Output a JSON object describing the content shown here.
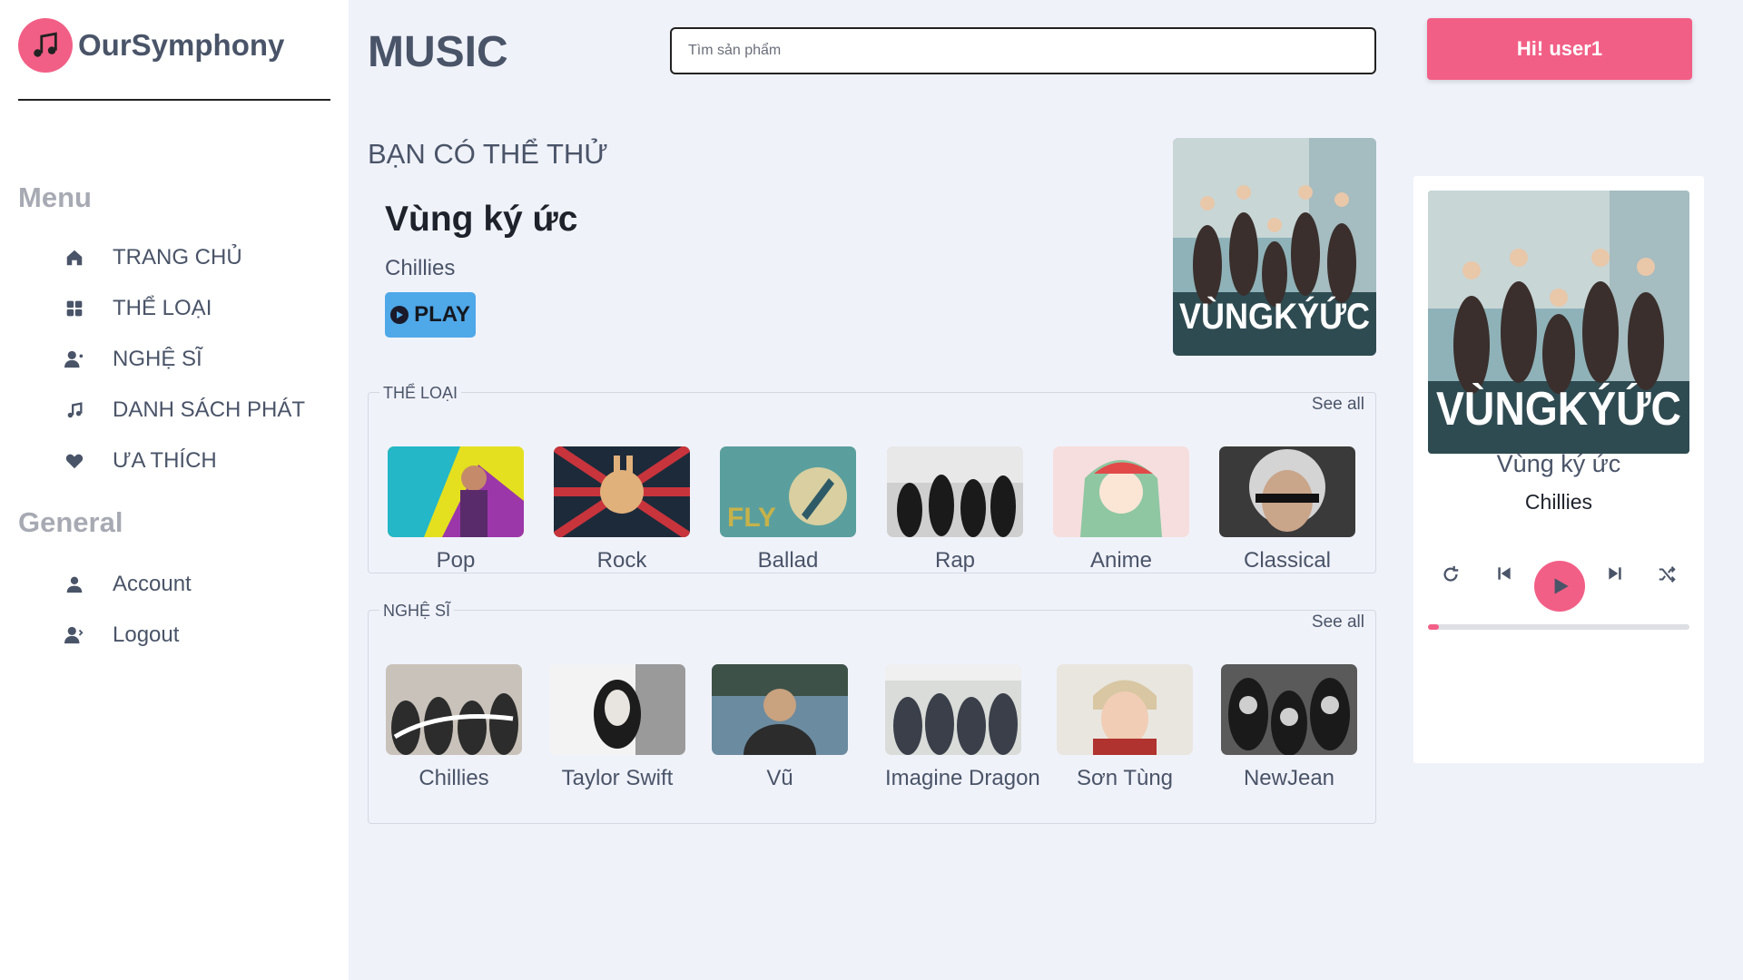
{
  "brand": {
    "name": "OurSymphony"
  },
  "sidebar": {
    "menu_title": "Menu",
    "menu_items": [
      {
        "label": "TRANG CHỦ",
        "icon": "home-icon"
      },
      {
        "label": "THỂ LOẠI",
        "icon": "category-icon"
      },
      {
        "label": "NGHỆ SĨ",
        "icon": "artist-icon"
      },
      {
        "label": "DANH SÁCH PHÁT",
        "icon": "playlist-icon"
      },
      {
        "label": "ƯA THÍCH",
        "icon": "heart-icon"
      }
    ],
    "general_title": "General",
    "general_items": [
      {
        "label": "Account",
        "icon": "user-icon"
      },
      {
        "label": "Logout",
        "icon": "logout-icon"
      }
    ]
  },
  "header": {
    "title": "MUSIC",
    "search_placeholder": "Tìm sản phẩm",
    "user_button": "Hi! user1"
  },
  "suggestion": {
    "heading": "BẠN CÓ THỂ THỬ",
    "song": "Vùng ký ức",
    "artist": "Chillies",
    "play_label": "PLAY",
    "cover_text": "VÙNGKÝỨC"
  },
  "genres": {
    "label": "THỂ LOẠI",
    "see_all": "See all",
    "items": [
      "Pop",
      "Rock",
      "Ballad",
      "Rap",
      "Anime",
      "Classical"
    ]
  },
  "artists": {
    "label": "NGHỆ SĨ",
    "see_all": "See all",
    "items": [
      "Chillies",
      "Taylor Swift",
      "Vũ",
      "Imagine Dragon",
      "Sơn Tùng",
      "NewJean"
    ]
  },
  "player": {
    "song": "Vùng ký ức",
    "artist": "Chillies",
    "progress": 0.04,
    "cover_text": "VÙNGKÝỨC"
  },
  "colors": {
    "accent": "#f25f86",
    "play_blue": "#4fa8e8",
    "text": "#4a5468"
  }
}
